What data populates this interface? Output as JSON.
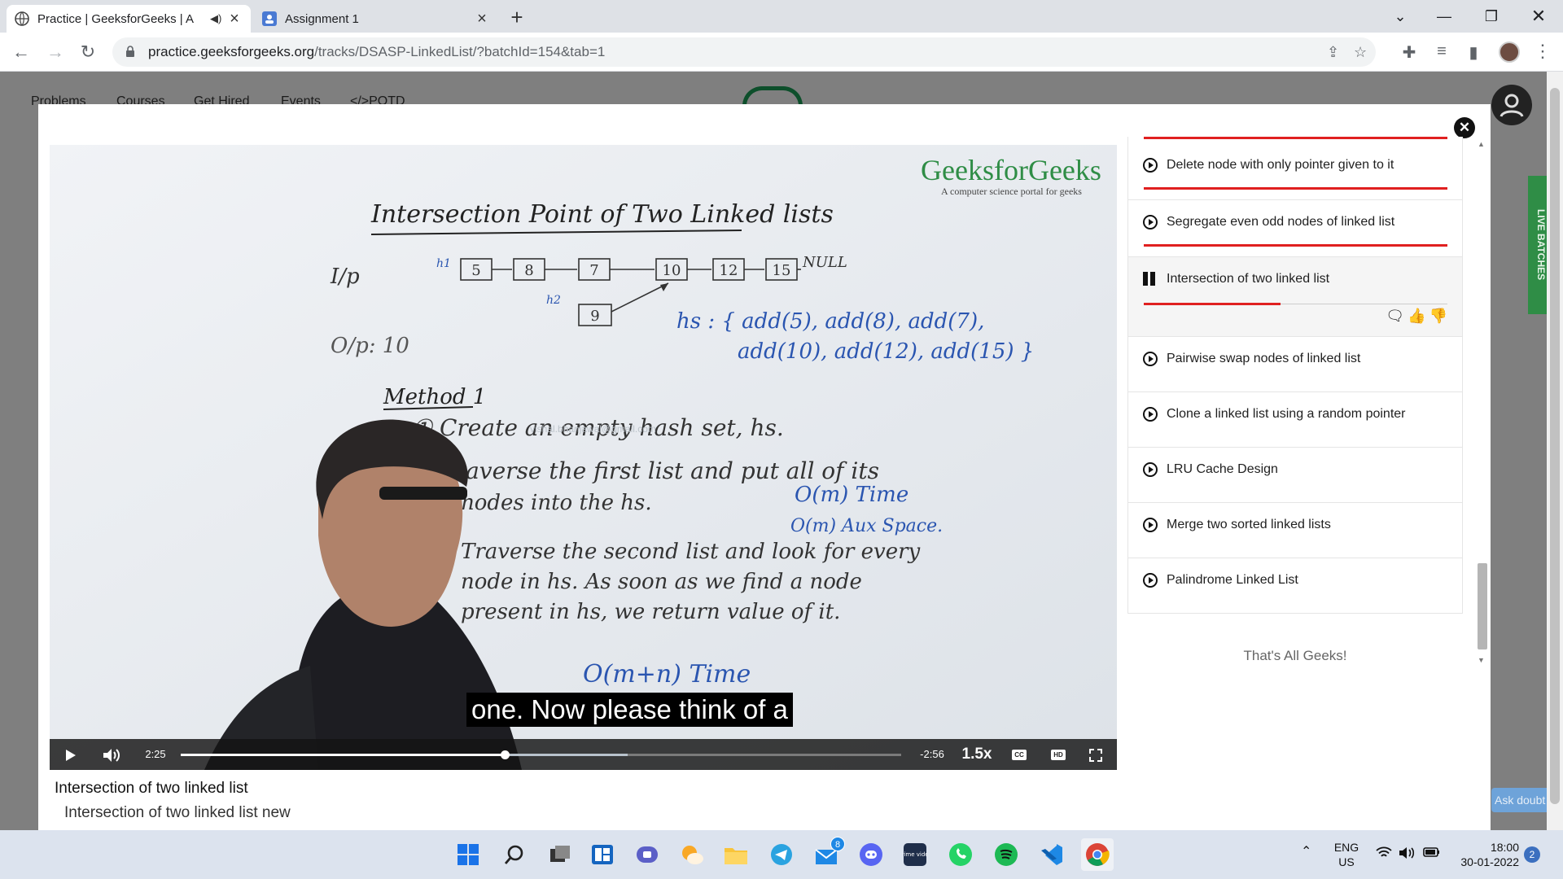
{
  "browser": {
    "tabs": [
      {
        "title": "Practice | GeeksforGeeks | A",
        "active": true
      },
      {
        "title": "Assignment 1",
        "active": false
      }
    ],
    "url_host": "practice.geeksforgeeks.org",
    "url_path": "/tracks/DSASP-LinkedList/?batchId=154&tab=1"
  },
  "site": {
    "nav": [
      "Problems",
      "Courses",
      "Get Hired",
      "Events",
      "</>POTD"
    ],
    "live_batches": "LIVE BATCHES",
    "ask_doubt": "Ask doubt"
  },
  "video": {
    "brand": "GeeksforGeeks",
    "brand_tagline": "A computer science portal for geeks",
    "watermark": "vishal.bhanjawal@gmail.com",
    "caption": "one. Now please think of a",
    "time_elapsed": "2:25",
    "time_remaining": "-2:56",
    "speed": "1.5x",
    "progress_fraction": 0.45,
    "board": {
      "heading": "Intersection Point of Two Linked lists",
      "ip": "I/p",
      "list1": [
        "5",
        "8",
        "7",
        "10",
        "12",
        "15"
      ],
      "null": "NULL",
      "list2": [
        "9"
      ],
      "h1": "h1",
      "h2": "h2",
      "hs_line1": "hs : { add(5), add(8), add(7),",
      "hs_line2": "add(10), add(12), add(15) }",
      "op": "O/p: 10",
      "method": "Method 1",
      "step1": "① Create an empty hash set, hs.",
      "step2a": "② Traverse the first list and put all of its",
      "step2b": "nodes into the hs.",
      "om_time": "O(m) Time",
      "om_space": "O(m) Aux Space.",
      "step3a": "Traverse the second list and look for every",
      "step3b": "node in hs. As soon as we find a node",
      "step3c": "present in hs, we return value of it.",
      "total": "O(m+n) Time"
    }
  },
  "video_title": "Intersection of two linked list",
  "video_subtitle": "Intersection of two linked list new",
  "playlist": {
    "items": [
      {
        "label": "Delete node with only pointer given to it",
        "state": "done"
      },
      {
        "label": "Segregate even odd nodes of linked list",
        "state": "done"
      },
      {
        "label": "Intersection of two linked list",
        "state": "playing",
        "progress": 0.45
      },
      {
        "label": "Pairwise swap nodes of linked list",
        "state": "todo"
      },
      {
        "label": "Clone a linked list using a random pointer",
        "state": "todo"
      },
      {
        "label": "LRU Cache Design",
        "state": "todo"
      },
      {
        "label": "Merge two sorted linked lists",
        "state": "todo"
      },
      {
        "label": "Palindrome Linked List",
        "state": "todo"
      }
    ],
    "footer": "That's All Geeks!"
  },
  "taskbar": {
    "lang_top": "ENG",
    "lang_bottom": "US",
    "time": "18:00",
    "date": "30-01-2022",
    "notification_count": "2",
    "mail_badge": "8",
    "prime_label": "prime video"
  },
  "colors": {
    "gfg_green": "#2f8d46",
    "progress_red": "#e02020",
    "marker_blue": "#2a55b0"
  }
}
